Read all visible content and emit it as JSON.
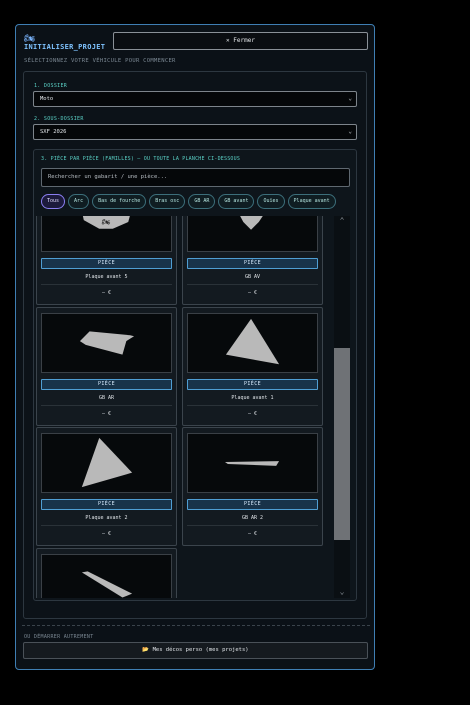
{
  "header": {
    "brand_icon": "🏍",
    "title": "INITIALISER_PROJET",
    "close_label": "✕ Fermer",
    "subtitle": "SÉLECTIONNEZ VOTRE VÉHICULE POUR COMMENCER"
  },
  "folder": {
    "label": "1. DOSSIER",
    "value": "Moto"
  },
  "subfolder": {
    "label": "2. SOUS-DOSSIER",
    "value": "SXF 2026"
  },
  "pieces": {
    "title": "3. PIÈCE PAR PIÈCE (FAMILLES) — OU TOUTE LA PLANCHE CI-DESSOUS",
    "search_placeholder": "Rechercher un gabarit / une pièce...",
    "filters": [
      "Tous",
      "Arc",
      "Bas de fourche",
      "Bras osc",
      "GB AR",
      "GB avant",
      "Ouïes",
      "Plaque avant"
    ],
    "active_filter": "Tous",
    "cards": [
      {
        "badge": "PIÈCE",
        "name": "Plaque avant 5",
        "price": "— €",
        "shape": "plate-icon"
      },
      {
        "badge": "PIÈCE",
        "name": "GB AV",
        "price": "— €",
        "shape": "fork-guard-icon"
      },
      {
        "badge": "PIÈCE",
        "name": "GB AR",
        "price": "— €",
        "shape": "rear-guard-icon"
      },
      {
        "badge": "PIÈCE",
        "name": "Plaque avant 1",
        "price": "— €",
        "shape": "triangle-plate-icon"
      },
      {
        "badge": "PIÈCE",
        "name": "Plaque avant 2",
        "price": "— €",
        "shape": "side-plate-icon"
      },
      {
        "badge": "PIÈCE",
        "name": "GB AR 2",
        "price": "— €",
        "shape": "strip-icon"
      },
      {
        "badge": "",
        "name": "",
        "price": "",
        "shape": "slash-icon"
      }
    ]
  },
  "footer": {
    "alt_label": "OU DÉMARRER AUTREMENT",
    "projects_label": "📂 Mes décos perso (mes projets)"
  },
  "colors": {
    "accent_border": "#3f7fb4",
    "teal_label": "#5bd2c7",
    "badge_fill": "#18334a",
    "active_chip": "#8a7ef0"
  }
}
